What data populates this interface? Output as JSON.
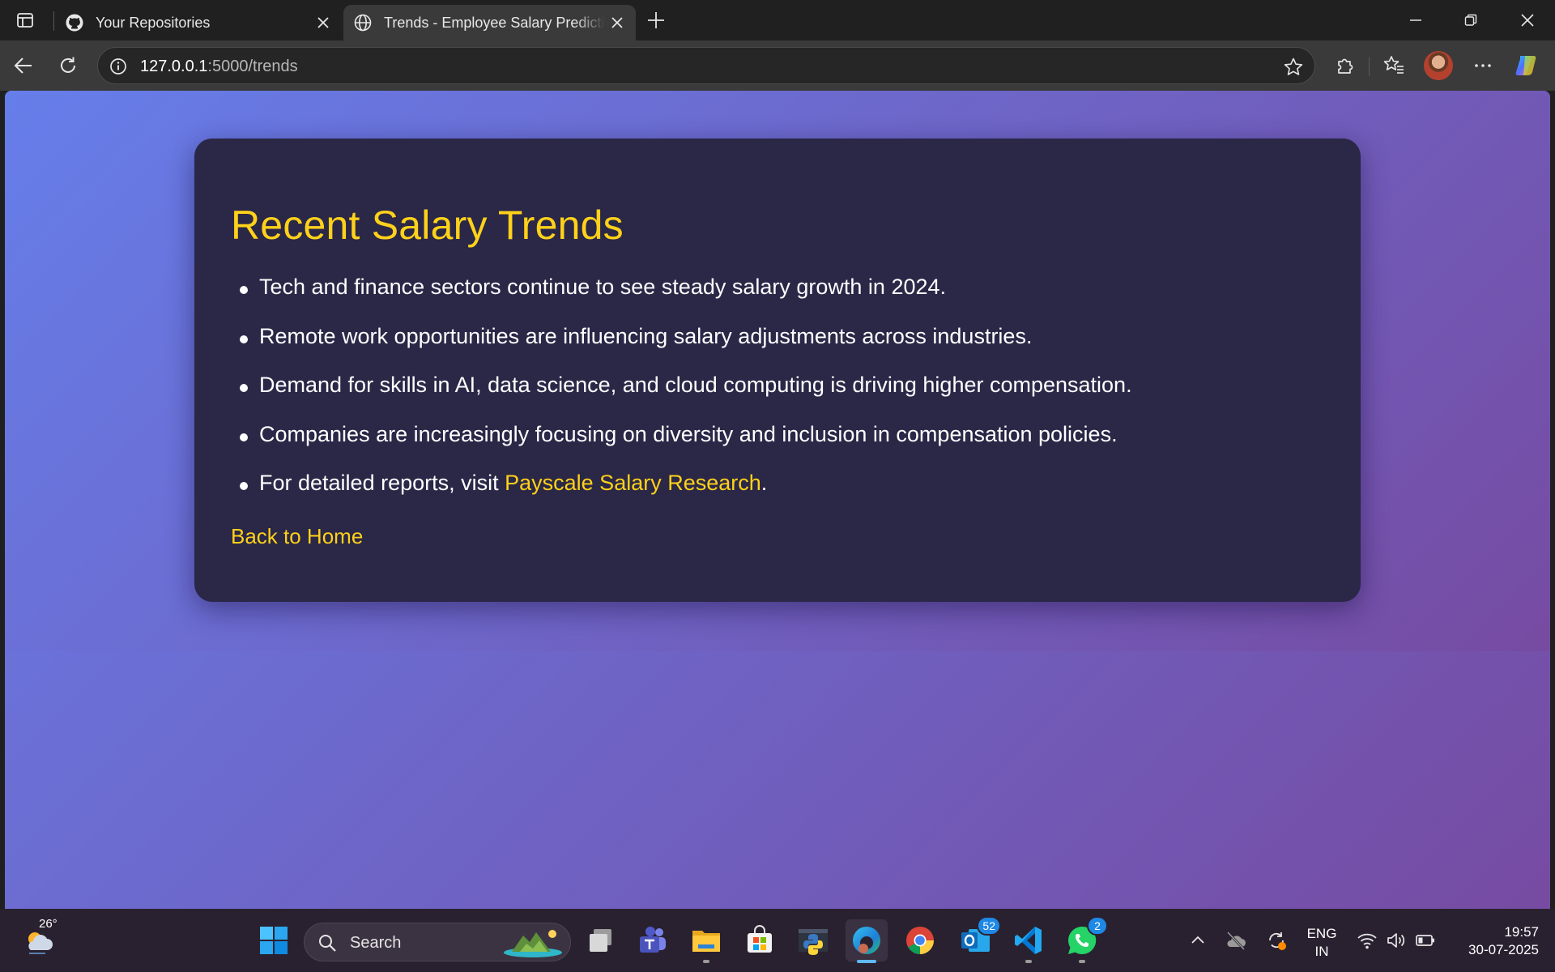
{
  "browser": {
    "tabs": [
      {
        "label": "Your Repositories",
        "icon": "github-icon",
        "active": false
      },
      {
        "label": "Trends - Employee Salary Prediction",
        "icon": "globe-icon",
        "active": true
      }
    ],
    "address": {
      "host": "127.0.0.1",
      "path": ":5000/trends"
    }
  },
  "page": {
    "heading": "Recent Salary Trends",
    "items": [
      "Tech and finance sectors continue to see steady salary growth in 2024.",
      "Remote work opportunities are influencing salary adjustments across industries.",
      "Demand for skills in AI, data science, and cloud computing is driving higher compensation.",
      "Companies are increasingly focusing on diversity and inclusion in compensation policies."
    ],
    "last_item_prefix": "For detailed reports, visit ",
    "last_item_link": "Payscale Salary Research",
    "last_item_suffix": ".",
    "back_link": "Back to Home",
    "colors": {
      "accent": "#ffd11a",
      "card": "#2a2747",
      "gradient_start": "#667eea",
      "gradient_end": "#764ba2"
    }
  },
  "taskbar": {
    "weather_temp": "26°",
    "search_placeholder": "Search",
    "outlook_badge": "52",
    "whatsapp_badge": "2",
    "lang_line1": "ENG",
    "lang_line2": "IN",
    "time": "19:57",
    "date": "30-07-2025"
  }
}
